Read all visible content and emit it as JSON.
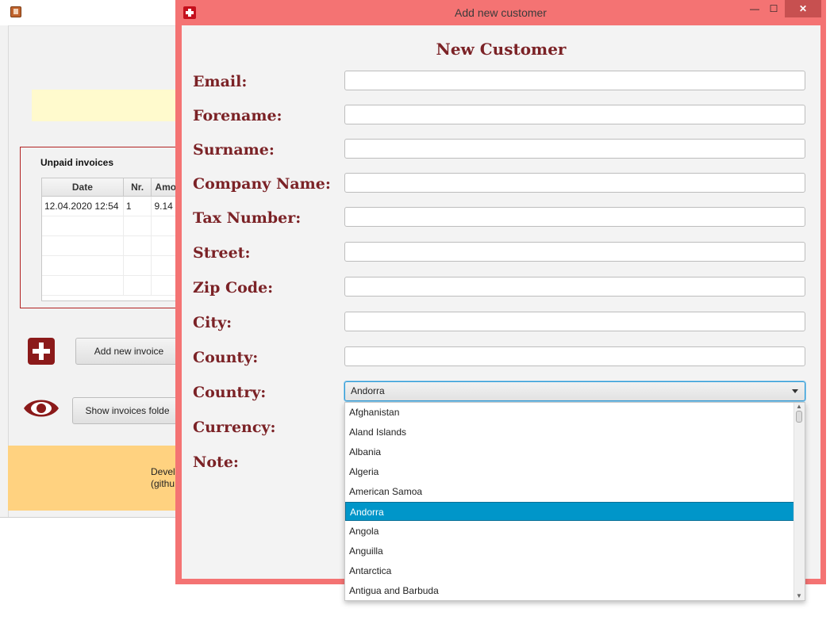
{
  "main_window": {
    "unpaid_invoices": {
      "title": "Unpaid invoices",
      "columns": [
        "Date",
        "Nr.",
        "Amo"
      ],
      "rows": [
        [
          "12.04.2020 12:54",
          "1",
          "9.14"
        ]
      ]
    },
    "add_invoice_label": "Add new invoice",
    "show_folder_label": "Show invoices folde",
    "footer_line1": "Develo",
    "footer_line2": "(githu"
  },
  "dialog": {
    "title": "Add new customer",
    "window_controls": {
      "minimize": "—",
      "maximize": "☐",
      "close": "✕"
    },
    "heading": "New Customer",
    "labels": {
      "email": "Email:",
      "forename": "Forename:",
      "surname": "Surname:",
      "company": "Company Name:",
      "tax": "Tax Number:",
      "street": "Street:",
      "zip": "Zip Code:",
      "city": "City:",
      "county": "County:",
      "country": "Country:",
      "currency": "Currency:",
      "note": "Note:"
    },
    "country_selected": "Andorra",
    "country_options": [
      "Afghanistan",
      "Aland Islands",
      "Albania",
      "Algeria",
      "American Samoa",
      "Andorra",
      "Angola",
      "Anguilla",
      "Antarctica",
      "Antigua and Barbuda"
    ]
  },
  "colors": {
    "dialog_border": "#f47373",
    "label_text": "#7b2226",
    "selection": "#0096c9",
    "footer": "#ffd280",
    "info_band": "#fffacd"
  }
}
